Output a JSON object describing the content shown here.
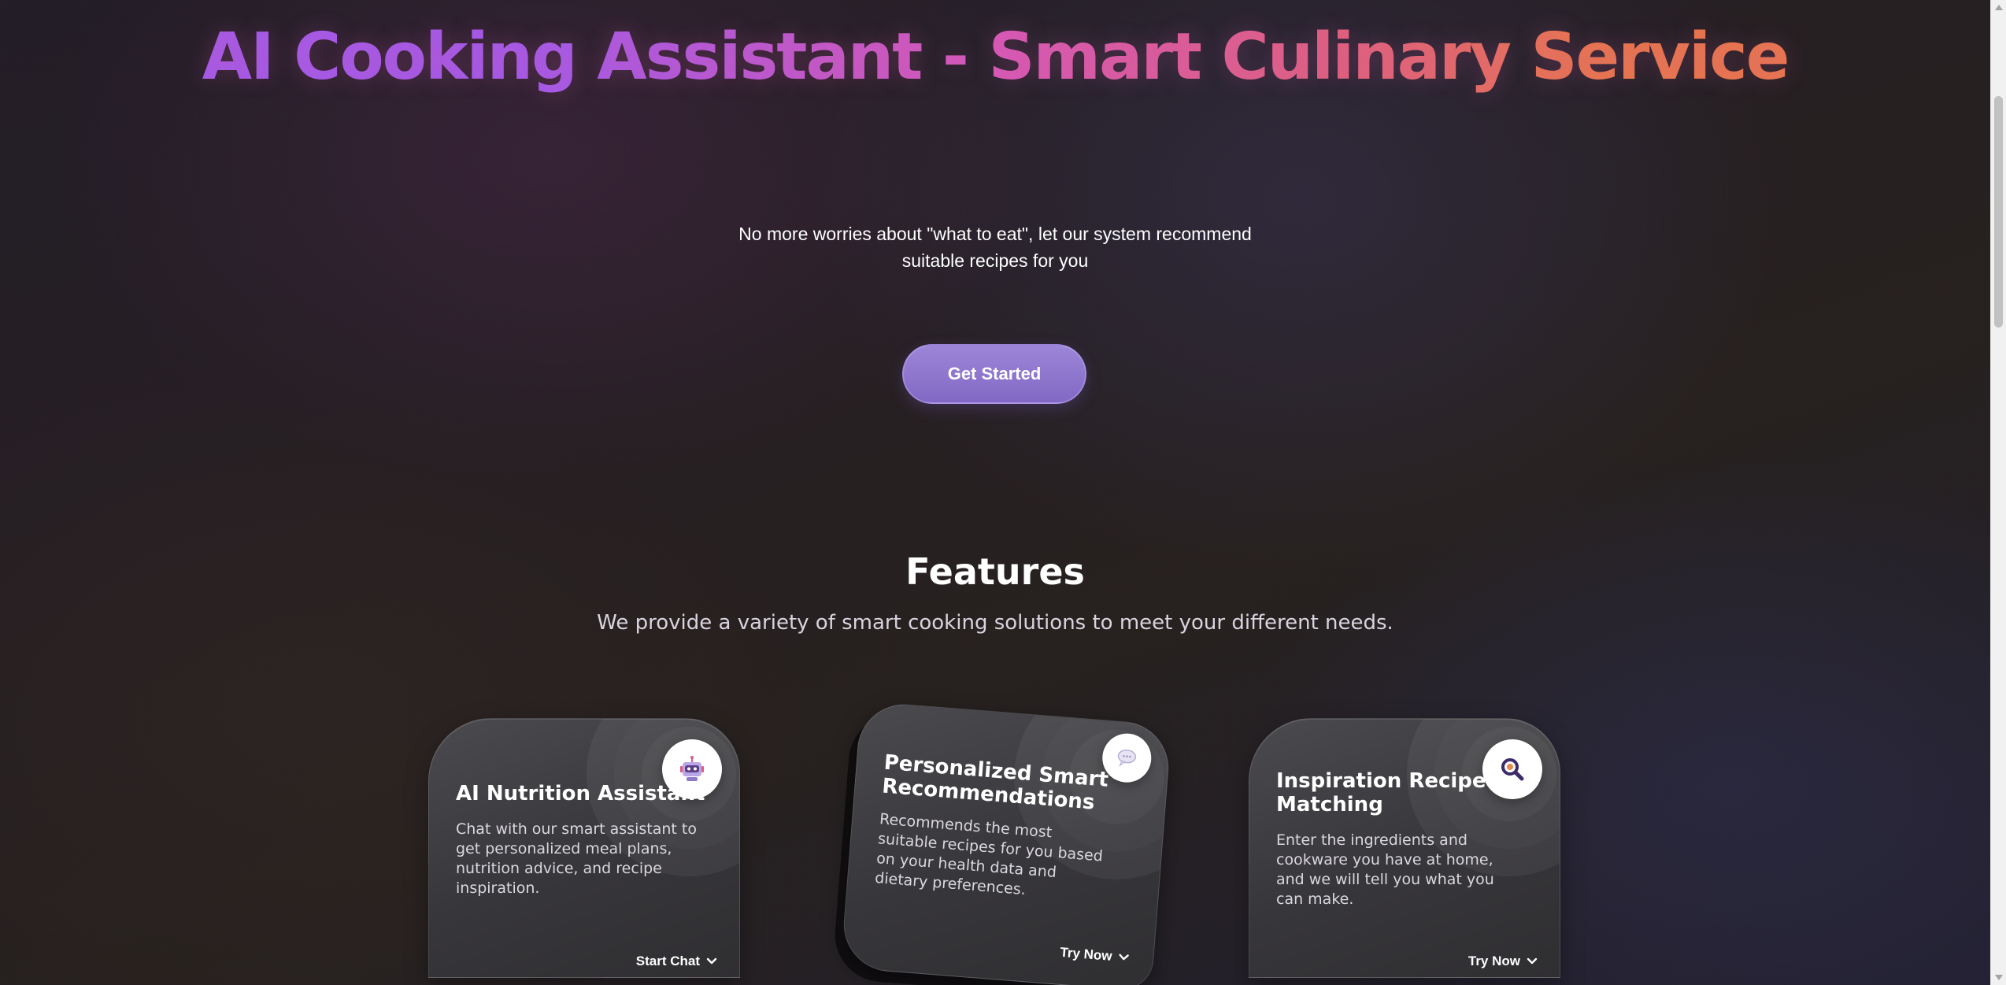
{
  "hero": {
    "title": "AI Cooking Assistant - Smart Culinary Service",
    "subtitle": "No more worries about \"what to eat\", let our system recommend suitable recipes for you",
    "cta_label": "Get Started"
  },
  "features": {
    "title": "Features",
    "subtitle": "We provide a variety of smart cooking solutions to meet your different needs.",
    "cards": [
      {
        "icon": "robot-icon",
        "title": "AI Nutrition Assistant",
        "description": "Chat with our smart assistant to get personalized meal plans, nutrition advice, and recipe inspiration.",
        "action_label": "Start Chat"
      },
      {
        "icon": "speech-bubble-icon",
        "title": "Personalized Smart Recommendations",
        "description": "Recommends the most suitable recipes for you based on your health data and dietary preferences.",
        "action_label": "Try Now"
      },
      {
        "icon": "magnifier-icon",
        "title": "Inspiration Recipe Matching",
        "description": "Enter the ingredients and cookware you have at home, and we will tell you what you can make.",
        "action_label": "Try Now"
      }
    ]
  },
  "colors": {
    "title_gradient": [
      "#a35ae8",
      "#d659b6",
      "#e0627b",
      "#e8774a"
    ],
    "cta_background": "#8c74cc",
    "card_background": "#3a393d"
  }
}
